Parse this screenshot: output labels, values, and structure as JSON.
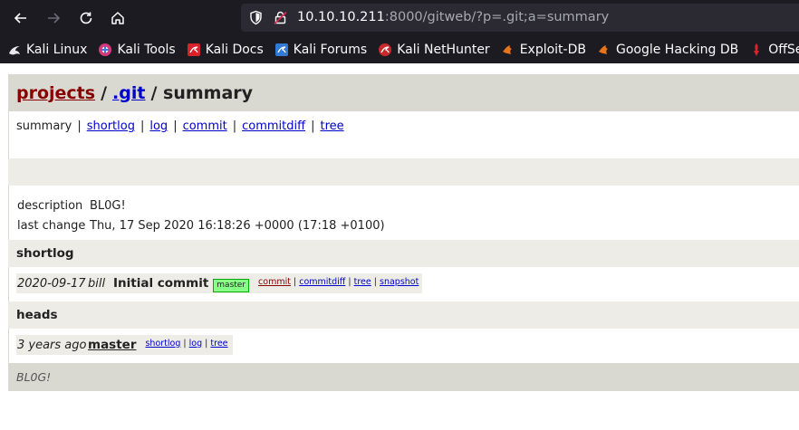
{
  "browser": {
    "url_host": "10.10.10.211",
    "url_rest": ":8000/gitweb/?p=.git;a=summary",
    "bookmarks": [
      {
        "label": "Kali Linux",
        "icon": "kali-dragon-icon"
      },
      {
        "label": "Kali Tools",
        "icon": "kali-tools-icon"
      },
      {
        "label": "Kali Docs",
        "icon": "kali-docs-icon"
      },
      {
        "label": "Kali Forums",
        "icon": "kali-forums-icon"
      },
      {
        "label": "Kali NetHunter",
        "icon": "nethunter-icon"
      },
      {
        "label": "Exploit-DB",
        "icon": "exploit-db-icon"
      },
      {
        "label": "Google Hacking DB",
        "icon": "ghdb-icon"
      },
      {
        "label": "OffSec",
        "icon": "offsec-icon"
      }
    ]
  },
  "header": {
    "projects": "projects",
    "separator": "/",
    "repo": ".git",
    "action": "/ summary"
  },
  "nav": {
    "current": "summary",
    "links": [
      "shortlog",
      "log",
      "commit",
      "commitdiff",
      "tree"
    ],
    "pipe": "|"
  },
  "project_info": {
    "description_key": "description",
    "description_value": "BL0G!",
    "last_change_key": "last change",
    "last_change_value": "Thu, 17 Sep 2020 16:18:26 +0000 (17:18 +0100)"
  },
  "shortlog": {
    "title": "shortlog",
    "entries": [
      {
        "date": "2020-09-17",
        "author": "bill",
        "message": "Initial commit",
        "ref": "master",
        "links": [
          "commit",
          "commitdiff",
          "tree",
          "snapshot"
        ]
      }
    ]
  },
  "heads": {
    "title": "heads",
    "entries": [
      {
        "age": "3 years ago",
        "name": "master",
        "links": [
          "shortlog",
          "log",
          "tree"
        ]
      }
    ]
  },
  "footer": {
    "text": "BL0G!"
  },
  "colors": {
    "chrome_bg": "#1c1b22",
    "urlbar_bg": "#2b2a33",
    "gitweb_header": "#d9d8d1",
    "gitweb_light": "#edece6",
    "link": "#0000cc",
    "projects_link": "#880000",
    "badge_bg": "#88ff88"
  }
}
